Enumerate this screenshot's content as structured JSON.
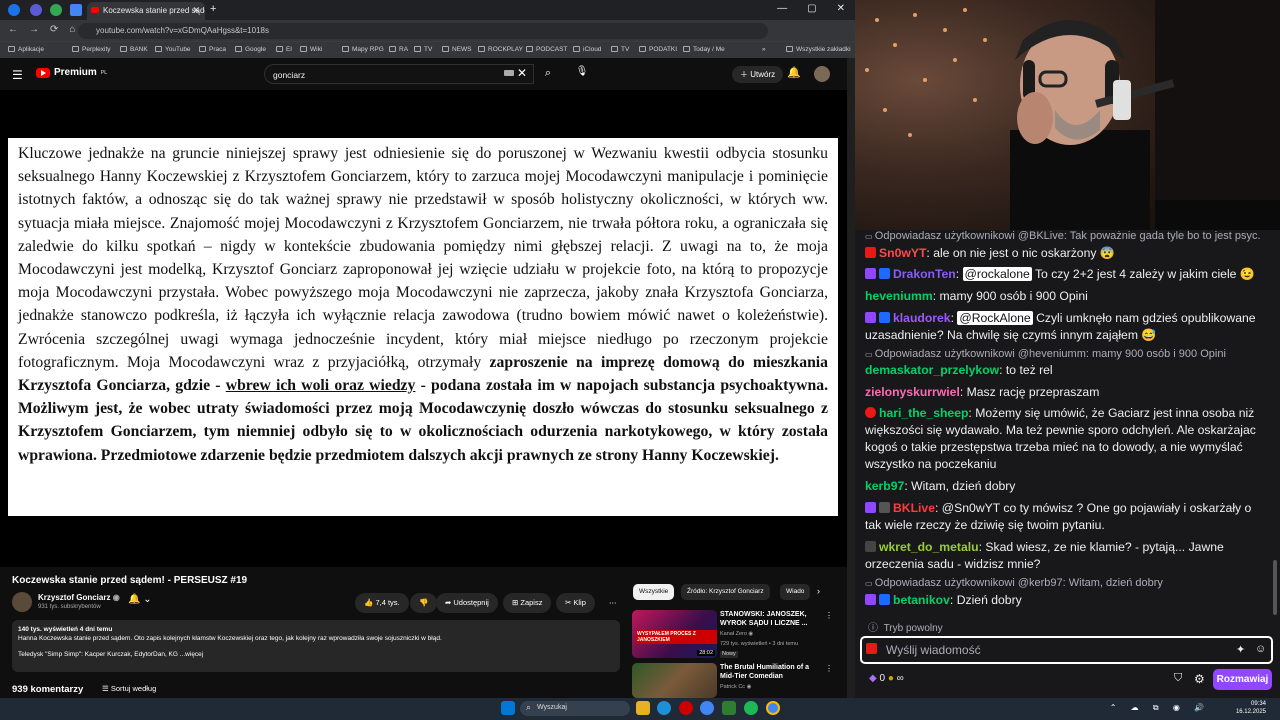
{
  "browser": {
    "tab_title": "Koczewska stanie przed sądem!",
    "tab_close": "✕",
    "new_tab": "+",
    "url": "youtube.com/watch?v=xGDmQAaHgss&t=1018s",
    "window_controls": [
      "—",
      "▢",
      "✕"
    ],
    "nav": [
      "←",
      "→",
      "⟳",
      "⌂"
    ],
    "bookmarks": [
      "Aplikacje",
      "Perplexity",
      "BANK",
      "YouTube",
      "Praca",
      "Google",
      "El",
      "Wiki",
      "Mapy RPG",
      "RA",
      "TV",
      "NEWS",
      "ROCKPLAY",
      "PODCAST",
      "iCloud",
      "TV",
      "PODATKI",
      "Today / Me"
    ],
    "bookmarks_more": "»",
    "bookmarks_all": "Wszystkie zakładki"
  },
  "youtube": {
    "logo": "Premium",
    "logo_sup": "PL",
    "search_value": "gonciarz",
    "create_label": "Utwórz",
    "video_title": "Koczewska stanie przed sądem! - PERSEUSZ #19",
    "channel_name": "Krzysztof Gonciarz",
    "channel_subs": "931 tys. subskrybentów",
    "likes": "7,4 tys.",
    "share": "Udostępnij",
    "save": "Zapisz",
    "clip": "Klip",
    "more": "⋯",
    "desc_meta": "140 tys. wyświetleń  4 dni temu",
    "desc_line1": "Hanna Koczewska stanie przed sądem. Oto zapis kolejnych kłamstw Koczewskiej oraz tego, jak kolejny raz wprowadziła swoje sojuszniczki w błąd.",
    "desc_line2": "Teledysk \"Simp Simp\": Kacper Kurczak, EdytorDan, KG ...więcej",
    "comments_count": "939 komentarzy",
    "sort_label": "Sortuj według",
    "chips": [
      "Wszystkie",
      "Źródło: Krzysztof Gonciarz",
      "Wiado"
    ],
    "recommendations": [
      {
        "title": "STANOWSKI: JANOSZEK, WYROK SĄDU I LICZNE ...",
        "channel": "Kanał Zero",
        "meta": "729 tys. wyświetleń • 3 dni temu",
        "badge": "Nowy",
        "duration": "28:02",
        "thumb_text": "WYSYPAŁEM PROCES Z JANOSZKIEM"
      },
      {
        "title": "The Brutal Humiliation of a Mid-Tier Comedian",
        "channel": "Patrick Cc",
        "meta": "",
        "badge": "",
        "duration": "",
        "thumb_text": ""
      }
    ]
  },
  "document": {
    "p1": "Kluczowe jednakże na gruncie niniejszej sprawy jest odniesienie się do poruszonej w Wezwaniu kwestii odbycia stosunku seksualnego Hanny Koczewskiej z Krzysztofem Gonciarzem, który to zarzuca mojej Mocodawczyni manipulacje i pominięcie istotnych faktów, a odnosząc się do tak ważnej sprawy nie przedstawił w sposób holistyczny okoliczności, w których ww. sytuacja miała miejsce. Znajomość mojej Mocodawczyni z Krzysztofem Gonciarzem, nie trwała półtora roku, a ograniczała się zaledwie do kilku spotkań – nigdy w kontekście zbudowania pomiędzy nimi głębszej relacji. Z uwagi na to, że moja Mocodawczyni jest modelką, Krzysztof Gonciarz zaproponował jej wzięcie udziału w projekcie foto, na którą to propozycje moja Mocodawczyni przystała. Wobec powyższego moja Mocodawczyni nie zaprzecza, jakoby znała Krzysztofa Gonciarza, jednakże stanowczo podkreśla, iż łączyła ich wyłącznie relacja zawodowa (trudno bowiem mówić nawet o koleżeństwie). Zwrócenia szczególnej uwagi wymaga jednocześnie incydent, który miał miejsce niedługo po rzeczonym projekcie fotograficznym. Moja Mocodawczyni wraz z przyjaciółką, otrzymały",
    "b1": "zaproszenie na imprezę domową do mieszkania Krzysztofa Gonciarza, gdzie -",
    "u1": "wbrew ich woli oraz wiedzy",
    "b2": "- podana została im w napojach substancja psychoaktywna. Możliwym jest, że wobec utraty świadomości przez moją Mocodawczynię doszło wówczas do stosunku seksualnego z Krzysztofem Gonciarzem, tym niemniej odbyło się to w okolicznościach odurzenia narkotykowego, w który została wprawiona. Przedmiotowe zdarzenie będzie przedmiotem dalszych akcji prawnych ze strony Hanny Koczewskiej."
  },
  "chat": {
    "messages": [
      {
        "type": "reply",
        "text": "Odpowiadasz użytkownikowi @BKLive: Tak poważnie gada tyle bo to jest psyc..."
      },
      {
        "type": "msg",
        "user": "Sn0wYT",
        "color": "#ff4a4a",
        "text": "ale on nie jest o nic oskarżony 😨"
      },
      {
        "type": "msg",
        "user": "DrakonTen",
        "color": "#8a5cf6",
        "mention": "@rockalone",
        "text": "To czy 2+2 jest 4 zależy w jakim ciele 😉"
      },
      {
        "type": "msg",
        "user": "heveniumm",
        "color": "#00d26a",
        "text": "mamy 900 osób i 900 Opini"
      },
      {
        "type": "msg",
        "user": "klaudorek",
        "color": "#9b59ff",
        "mention": "@RockAlone",
        "text": "Czyli umknęło nam gdzieś opublikowane uzasadnienie? Na chwilę się czymś innym zająłem 😅"
      },
      {
        "type": "reply",
        "text": "Odpowiadasz użytkownikowi @heveniumm: mamy 900 osób i 900 Opini"
      },
      {
        "type": "msg",
        "user": "demaskator_przelykow",
        "color": "#00d26a",
        "text": "to też rel"
      },
      {
        "type": "msg",
        "user": "zielonyskurrwiel",
        "color": "#ff69b4",
        "text": "Masz rację przepraszam"
      },
      {
        "type": "msg",
        "user": "hari_the_sheep",
        "color": "#00d26a",
        "text": "Możemy się umówić, że Gaciarz jest inna osoba niż większości się wydawało. Ma też pewnie sporo odchyleń. Ale oskarżajac kogoś o takie przestępstwa trzeba mieć na to dowody, a nie wymyślać wszystko na poczekaniu"
      },
      {
        "type": "msg",
        "user": "kerb97",
        "color": "#00d26a",
        "text": "Witam, dzień dobry"
      },
      {
        "type": "msg",
        "user": "BKLive",
        "color": "#ff3b3b",
        "text": "@Sn0wYT co ty mówisz ? One go pojawiały i oskarżały o tak wiele rzeczy że dziwię się twoim pytaniu."
      },
      {
        "type": "msg",
        "user": "wkret_do_metalu",
        "color": "#9acd32",
        "text": "Skad wiesz, ze nie klamie? - pytają... Jawne orzeczenia sadu - widzisz mnie?"
      },
      {
        "type": "reply",
        "text": "Odpowiadasz użytkownikowi @kerb97: Witam, dzień dobry"
      },
      {
        "type": "msg",
        "user": "betanikov",
        "color": "#00d26a",
        "text": "Dzień dobry"
      }
    ],
    "mode": "Tryb powolny",
    "input_placeholder": "Wyślij wiadomość",
    "bits": "0",
    "send": "Rozmawiaj"
  },
  "taskbar": {
    "search": "Wyszukaj",
    "time": "09:34",
    "date": "16.12.2025",
    "tray": "⌃ ☁ ⧉ ◉ 🔊"
  }
}
